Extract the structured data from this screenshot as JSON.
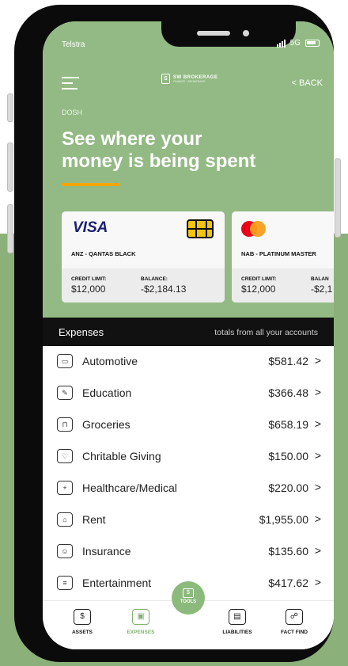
{
  "status": {
    "carrier": "Telstra",
    "network": "5G"
  },
  "header": {
    "brand_name": "SW BROKERAGE",
    "brand_tagline": "FINANCE · BROKERAGE",
    "back_label": "< BACK",
    "section": "DOSH",
    "headline_line1": "See where your",
    "headline_line2": "money is being spent"
  },
  "cards": [
    {
      "network": "VISA",
      "name": "ANZ - QANTAS BLACK",
      "credit_limit_label": "CREDIT LIMIT:",
      "credit_limit": "$12,000",
      "balance_label": "BALANCE:",
      "balance": "-$2,184.13"
    },
    {
      "network": "Mastercard",
      "name": "NAB - PLATINUM MASTER",
      "credit_limit_label": "CREDIT LIMIT:",
      "credit_limit": "$12,000",
      "balance_label": "BALAN",
      "balance": "-$2,1"
    }
  ],
  "expenses": {
    "title": "Expenses",
    "subtitle": "totals from all your accounts",
    "items": [
      {
        "name": "Automotive",
        "value": "$581.42",
        "icon": "car-icon"
      },
      {
        "name": "Education",
        "value": "$366.48",
        "icon": "education-icon"
      },
      {
        "name": "Groceries",
        "value": "$658.19",
        "icon": "groceries-icon"
      },
      {
        "name": "Chritable Giving",
        "value": "$150.00",
        "icon": "charity-icon"
      },
      {
        "name": "Healthcare/Medical",
        "value": "$220.00",
        "icon": "healthcare-icon"
      },
      {
        "name": "Rent",
        "value": "$1,955.00",
        "icon": "rent-icon"
      },
      {
        "name": "Insurance",
        "value": "$135.60",
        "icon": "insurance-icon"
      },
      {
        "name": "Entertainment",
        "value": "$417.62",
        "icon": "entertainment-icon"
      }
    ]
  },
  "tabbar": {
    "assets": "ASSETS",
    "expenses": "EXPENSES",
    "tools": "TOOLS",
    "liabilities": "LIABILITIES",
    "fact_find": "FACT FIND"
  },
  "colors": {
    "accent": "#93ba84",
    "underline": "#f2a600",
    "active_tab": "#7fb06e"
  }
}
